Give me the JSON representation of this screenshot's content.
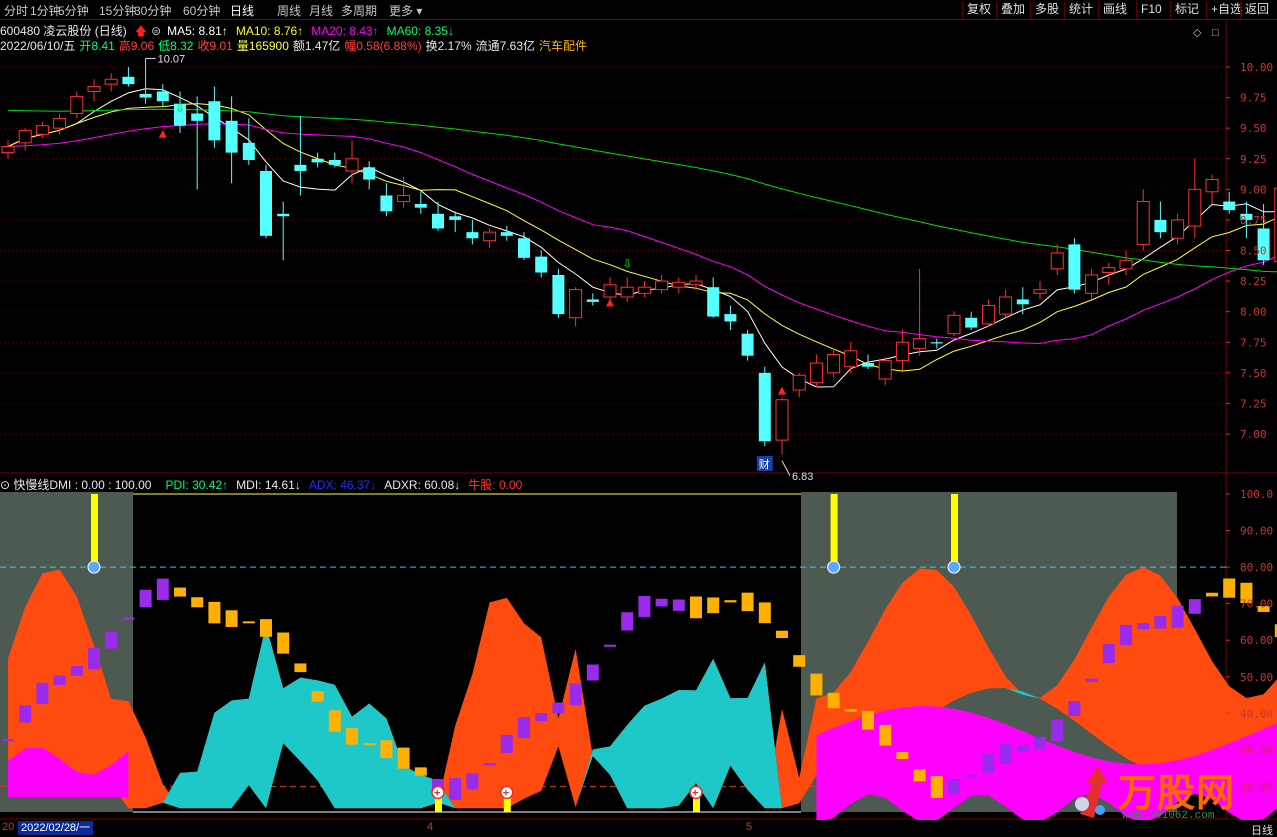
{
  "toolbar": {
    "periods": [
      "分时",
      "1分钟",
      "5分钟",
      "15分钟",
      "30分钟",
      "60分钟",
      "日线",
      "周线",
      "月线",
      "多周期",
      "更多"
    ],
    "active_period": "日线",
    "right_buttons": [
      "复权",
      "叠加",
      "多股",
      "统计",
      "画线",
      "F10",
      "标记",
      "+自选",
      "返回"
    ]
  },
  "stock": {
    "code": "600480",
    "name": "凌云股份",
    "period_label": "(日线)",
    "ma": [
      {
        "label": "MA5:",
        "value": "8.81",
        "dir": "↑",
        "color": "#ffffff"
      },
      {
        "label": "MA10:",
        "value": "8.76",
        "dir": "↑",
        "color": "#ffff00"
      },
      {
        "label": "MA20:",
        "value": "8.43",
        "dir": "↑",
        "color": "#ff00ff"
      },
      {
        "label": "MA60:",
        "value": "8.35",
        "dir": "↓",
        "color": "#00ff00"
      }
    ],
    "date": "2022/06/10/五",
    "open_label": "开",
    "open": "8.41",
    "high_label": "高",
    "high": "9.06",
    "low_label": "低",
    "low": "8.32",
    "close_label": "收",
    "close": "9.01",
    "vol_label": "量",
    "vol": "165900",
    "amount_label": "额",
    "amount": "1.47亿",
    "change_label": "幅",
    "change": "0.58(6.88%)",
    "turnover_label": "换",
    "turnover": "2.17%",
    "float_label": "流通",
    "float_cap": "7.63亿",
    "sector": "汽车配件"
  },
  "price_axis": {
    "ticks": [
      "10.00",
      "9.75",
      "9.50",
      "9.25",
      "9.00",
      "8.75",
      "8.50",
      "8.25",
      "8.00",
      "7.75",
      "7.50",
      "7.25",
      "7.00"
    ],
    "high_mark": "10.07",
    "low_mark": "6.83",
    "event_badge": "财"
  },
  "indicator": {
    "name": "快慢线DMI",
    "params": ": 0.00 : 100.00",
    "pdi_label": "PDI:",
    "pdi": "30.42",
    "pdi_dir": "↑",
    "mdi_label": "MDI:",
    "mdi": "14.61",
    "mdi_dir": "↓",
    "adx_label": "ADX:",
    "adx": "46.37",
    "adx_dir": "↓",
    "adxr_label": "ADXR:",
    "adxr": "60.08",
    "adxr_dir": "↓",
    "bull_label": "牛股:",
    "bull": "0.00",
    "ticks": [
      "100.0",
      "90.00",
      "80.00",
      "70.00",
      "60.00",
      "50.00",
      "40.00",
      "30.00",
      "20.00"
    ]
  },
  "date_axis": {
    "cursor_date": "2022/02/28/一",
    "left_label": "20",
    "month_labels": [
      "4",
      "5"
    ],
    "tab": "日线"
  },
  "watermark": {
    "brand": "万股网",
    "url": "www.201062.com"
  },
  "chart_data": {
    "type": "candlestick",
    "candles": [
      [
        9.3,
        9.4,
        9.25,
        9.35
      ],
      [
        9.38,
        9.5,
        9.32,
        9.48
      ],
      [
        9.45,
        9.55,
        9.42,
        9.52
      ],
      [
        9.5,
        9.62,
        9.45,
        9.58
      ],
      [
        9.62,
        9.8,
        9.58,
        9.76
      ],
      [
        9.8,
        9.9,
        9.72,
        9.84
      ],
      [
        9.86,
        9.95,
        9.8,
        9.9
      ],
      [
        9.92,
        10.0,
        9.84,
        9.86
      ],
      [
        9.78,
        10.07,
        9.7,
        9.75
      ],
      [
        9.8,
        9.86,
        9.68,
        9.72
      ],
      [
        9.7,
        9.8,
        9.46,
        9.52
      ],
      [
        9.62,
        9.76,
        9.0,
        9.56
      ],
      [
        9.72,
        9.84,
        9.34,
        9.4
      ],
      [
        9.56,
        9.76,
        9.05,
        9.3
      ],
      [
        9.38,
        9.58,
        9.2,
        9.24
      ],
      [
        9.15,
        9.2,
        8.6,
        8.62
      ],
      [
        8.8,
        8.9,
        8.42,
        8.78
      ],
      [
        9.2,
        9.6,
        8.95,
        9.15
      ],
      [
        9.25,
        9.3,
        9.18,
        9.22
      ],
      [
        9.24,
        9.3,
        9.18,
        9.2
      ],
      [
        9.15,
        9.4,
        9.05,
        9.25
      ],
      [
        9.18,
        9.23,
        9.0,
        9.08
      ],
      [
        8.95,
        9.05,
        8.78,
        8.82
      ],
      [
        8.9,
        9.1,
        8.85,
        8.95
      ],
      [
        8.88,
        8.98,
        8.8,
        8.85
      ],
      [
        8.8,
        8.9,
        8.66,
        8.68
      ],
      [
        8.78,
        8.82,
        8.65,
        8.75
      ],
      [
        8.65,
        8.75,
        8.55,
        8.6
      ],
      [
        8.58,
        8.68,
        8.52,
        8.65
      ],
      [
        8.65,
        8.7,
        8.58,
        8.62
      ],
      [
        8.6,
        8.65,
        8.42,
        8.44
      ],
      [
        8.45,
        8.5,
        8.28,
        8.32
      ],
      [
        8.3,
        8.35,
        7.95,
        7.98
      ],
      [
        7.95,
        8.2,
        7.88,
        8.18
      ],
      [
        8.1,
        8.15,
        8.05,
        8.08
      ],
      [
        8.12,
        8.28,
        8.08,
        8.22
      ],
      [
        8.12,
        8.28,
        8.08,
        8.2
      ],
      [
        8.15,
        8.25,
        8.12,
        8.2
      ],
      [
        8.18,
        8.3,
        8.15,
        8.25
      ],
      [
        8.2,
        8.28,
        8.15,
        8.24
      ],
      [
        8.22,
        8.3,
        8.18,
        8.25
      ],
      [
        8.2,
        8.28,
        7.95,
        7.96
      ],
      [
        7.98,
        8.05,
        7.85,
        7.92
      ],
      [
        7.82,
        7.85,
        7.6,
        7.64
      ],
      [
        7.5,
        7.55,
        6.9,
        6.94
      ],
      [
        6.95,
        7.3,
        6.83,
        7.28
      ],
      [
        7.36,
        7.5,
        7.3,
        7.48
      ],
      [
        7.42,
        7.65,
        7.38,
        7.58
      ],
      [
        7.5,
        7.7,
        7.46,
        7.65
      ],
      [
        7.55,
        7.75,
        7.5,
        7.68
      ],
      [
        7.58,
        7.65,
        7.53,
        7.55
      ],
      [
        7.45,
        7.63,
        7.4,
        7.6
      ],
      [
        7.6,
        7.85,
        7.52,
        7.75
      ],
      [
        7.7,
        8.35,
        7.64,
        7.78
      ],
      [
        7.75,
        7.78,
        7.7,
        7.74
      ],
      [
        7.82,
        8.0,
        7.8,
        7.97
      ],
      [
        7.95,
        8.0,
        7.85,
        7.87
      ],
      [
        7.9,
        8.1,
        7.88,
        8.05
      ],
      [
        7.98,
        8.18,
        7.95,
        8.12
      ],
      [
        8.1,
        8.2,
        7.98,
        8.06
      ],
      [
        8.15,
        8.25,
        8.1,
        8.18
      ],
      [
        8.35,
        8.55,
        8.3,
        8.48
      ],
      [
        8.55,
        8.6,
        8.15,
        8.18
      ],
      [
        8.15,
        8.35,
        8.1,
        8.3
      ],
      [
        8.32,
        8.4,
        8.22,
        8.36
      ],
      [
        8.35,
        8.5,
        8.3,
        8.42
      ],
      [
        8.55,
        9.0,
        8.5,
        8.9
      ],
      [
        8.75,
        8.9,
        8.6,
        8.65
      ],
      [
        8.6,
        8.8,
        8.55,
        8.75
      ],
      [
        8.7,
        9.25,
        8.6,
        9.0
      ],
      [
        8.98,
        9.12,
        8.88,
        9.08
      ],
      [
        8.9,
        8.98,
        8.8,
        8.83
      ],
      [
        8.8,
        8.9,
        8.6,
        8.75
      ],
      [
        8.68,
        8.88,
        8.38,
        8.42
      ],
      [
        8.41,
        9.06,
        8.32,
        9.01
      ]
    ],
    "price_range": [
      6.8,
      10.15
    ],
    "moving_averages": [
      "MA5",
      "MA10",
      "MA20",
      "MA60"
    ],
    "dmi_range": [
      13,
      103
    ],
    "reference_lines": [
      80,
      20
    ]
  }
}
